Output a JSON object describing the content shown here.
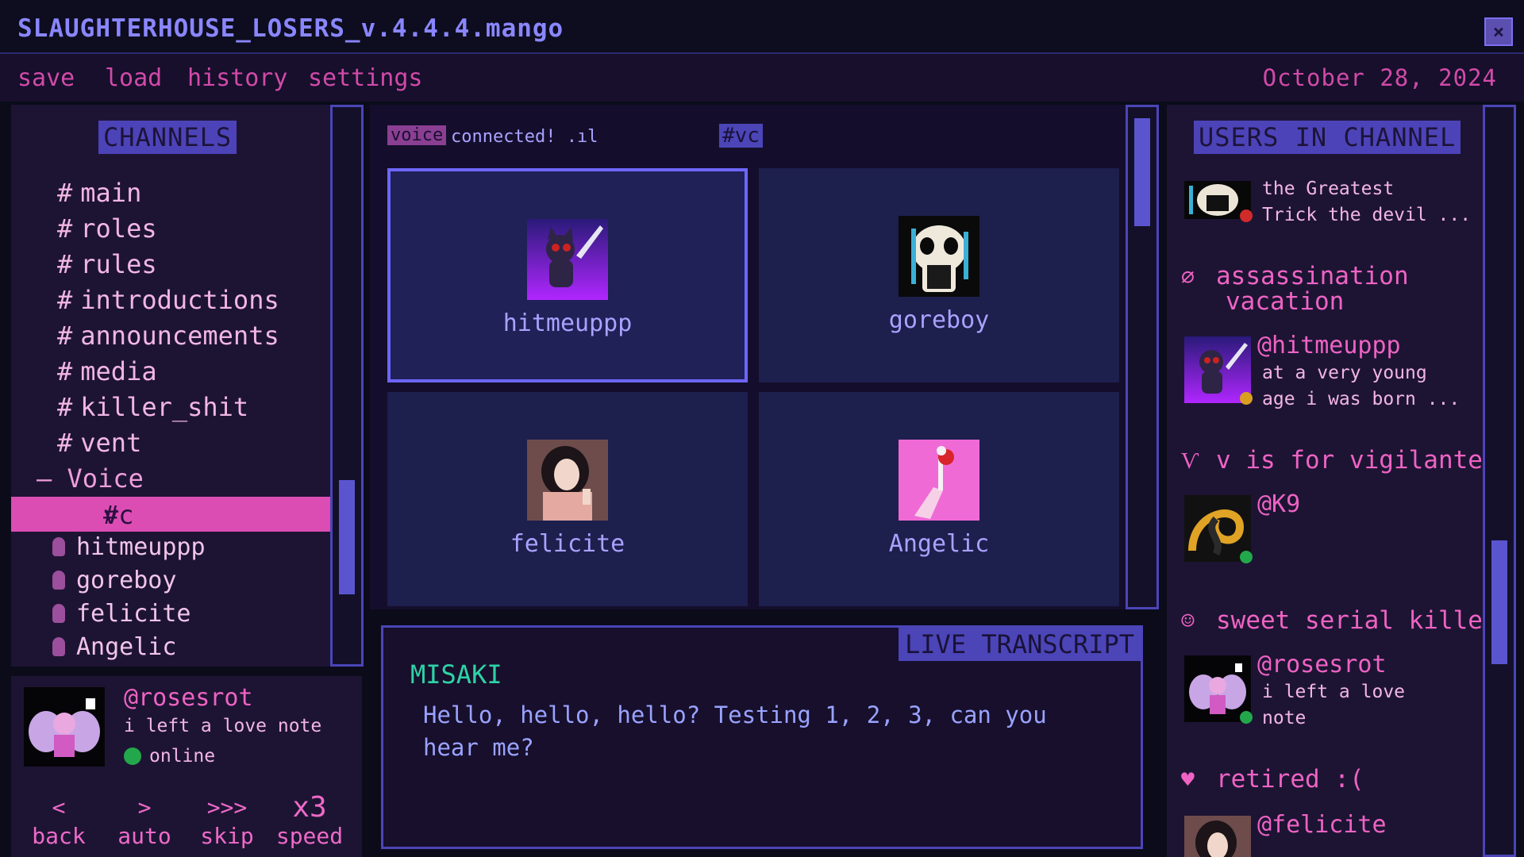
{
  "app": {
    "title": "SLAUGHTERHOUSE_LOSERS_v.4.4.4.mango",
    "close_icon": "close-icon"
  },
  "menu": {
    "items": [
      "save",
      "load",
      "history",
      "settings"
    ],
    "date": "October 28, 2024"
  },
  "channels": {
    "header": "CHANNELS",
    "text_channels": [
      "main",
      "roles",
      "rules",
      "introductions",
      "announcements",
      "media",
      "killer_shit",
      "vent"
    ],
    "hash": "#",
    "voice_category": "– Voice",
    "active_channel": "vc",
    "voice_users": [
      "hitmeuppp",
      "goreboy",
      "felicite",
      "Angelic"
    ]
  },
  "profile": {
    "name": "@rosesrot",
    "status": "i left a love note",
    "presence": "online"
  },
  "controls": {
    "back": {
      "icon": "<",
      "label": "back"
    },
    "auto": {
      "icon": ">",
      "label": "auto"
    },
    "skip": {
      "icon": ">>>",
      "label": "skip"
    },
    "speed": {
      "icon": "x3",
      "label": "speed"
    }
  },
  "call": {
    "voice_tag": "voice",
    "connected": "connected! .ıl",
    "channel_tag": "#vc",
    "participants": [
      {
        "name": "hitmeuppp",
        "selected": true
      },
      {
        "name": "goreboy",
        "selected": false
      },
      {
        "name": "felicite",
        "selected": false
      },
      {
        "name": "Angelic",
        "selected": false
      }
    ]
  },
  "transcript": {
    "header": "LIVE TRANSCRIPT",
    "speaker": "MISAKI",
    "text": "Hello, hello, hello? Testing 1, 2, 3, can you hear me?"
  },
  "users_panel": {
    "header": "USERS IN CHANNEL",
    "top_user_status_1": "the Greatest",
    "top_user_status_2": "Trick the devil ...",
    "groups": [
      {
        "icon": "∅",
        "label_1": "assassination",
        "label_2": "vacation"
      },
      {
        "icon": "Ѵ",
        "label_1": "v is for vigilante"
      },
      {
        "icon": "☺",
        "label_1": "sweet serial killer"
      },
      {
        "icon": "♥",
        "label_1": "retired :("
      }
    ],
    "users": [
      {
        "name": "@hitmeuppp",
        "status_1": "at a very young",
        "status_2": "age i was born ...",
        "presence_color": "#d9a020"
      },
      {
        "name": "@K9",
        "presence_color": "#22a84b"
      },
      {
        "name": "@rosesrot",
        "status_1": "i left a love",
        "status_2": "note",
        "presence_color": "#22a84b"
      },
      {
        "name": "@felicite"
      }
    ]
  },
  "colors": {
    "accent": "#dc4db3",
    "brand": "#4d43b8",
    "online": "#22a84b",
    "idle": "#d9a020",
    "dnd": "#d12a2a"
  }
}
